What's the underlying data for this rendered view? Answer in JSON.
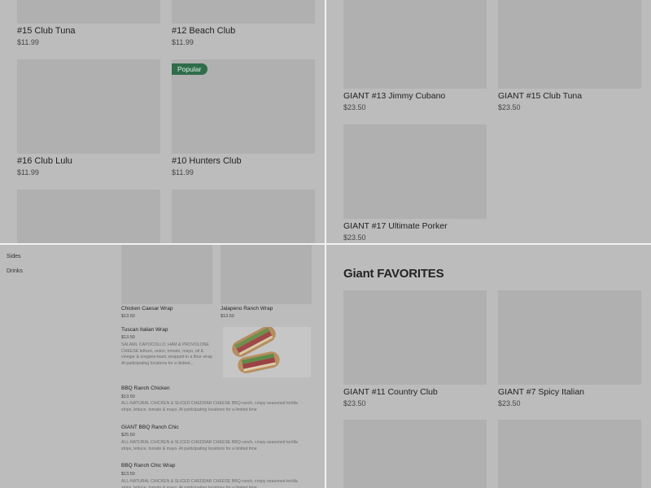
{
  "top_left": {
    "items": [
      {
        "name": "#15 Club Tuna",
        "price": "$11.99"
      },
      {
        "name": "#12 Beach Club",
        "price": "$11.99"
      },
      {
        "name": "#16 Club Lulu",
        "price": "$11.99"
      },
      {
        "name": "#10 Hunters Club",
        "price": "$11.99",
        "badge": "Popular"
      }
    ]
  },
  "top_right": {
    "items": [
      {
        "name": "GIANT #13 Jimmy Cubano",
        "price": "$23.50"
      },
      {
        "name": "GIANT #15 Club Tuna",
        "price": "$23.50"
      },
      {
        "name": "GIANT #17 Ultimate Porker",
        "price": "$23.50"
      }
    ]
  },
  "bottom_left": {
    "sidebar": [
      "Sides",
      "Drinks"
    ],
    "grid_items": [
      {
        "name": "Chicken Caesar Wrap",
        "price": "$13.50"
      },
      {
        "name": "Jalapeno Ranch Wrap",
        "price": "$13.50"
      }
    ],
    "list_items": [
      {
        "name": "Tuscan Italian Wrap",
        "price": "$13.50",
        "desc": "SALAMI, CAPOCOLLO, HAM & PROVOLONE CHEESE lettuce, onion, tomato, mayo, oil & vinegar & oregano-basil, wrapped in a flour wrap. At participating locations for a limited..."
      },
      {
        "name": "BBQ Ranch Chicken",
        "price": "$13.50",
        "desc": "ALL-NATURAL CHICKEN & SLICED CHEDDAR CHEESE BBQ ranch, crispy seasoned tortilla strips, lettuce, tomato & mayo. At participating locations for a limited time"
      },
      {
        "name": "GIANT BBQ Ranch Chic",
        "price": "$25.50",
        "desc": "ALL-NATURAL CHICKEN & SLICED CHEDDAR CHEESE BBQ ranch, crispy seasoned tortilla strips, lettuce, tomato & mayo. At participating locations for a limited time"
      },
      {
        "name": "BBQ Ranch Chic Wrap",
        "price": "$13.50",
        "desc": "ALL-NATURAL CHICKEN & SLICED CHEDDAR CHEESE BBQ ranch, crispy seasoned tortilla strips, lettuce, tomato & mayo. At participating locations for a limited time"
      }
    ]
  },
  "bottom_right": {
    "section_title": "Giant FAVORITES",
    "items": [
      {
        "name": "GIANT #11 Country Club",
        "price": "$23.50"
      },
      {
        "name": "GIANT #7 Spicy Italian",
        "price": "$23.50"
      }
    ]
  },
  "colors": {
    "overlay_background": "#bcbcbc",
    "image_placeholder": "#b0b0b0",
    "popular_badge": "#2f6d4a",
    "divider": "#f2f2f2"
  }
}
